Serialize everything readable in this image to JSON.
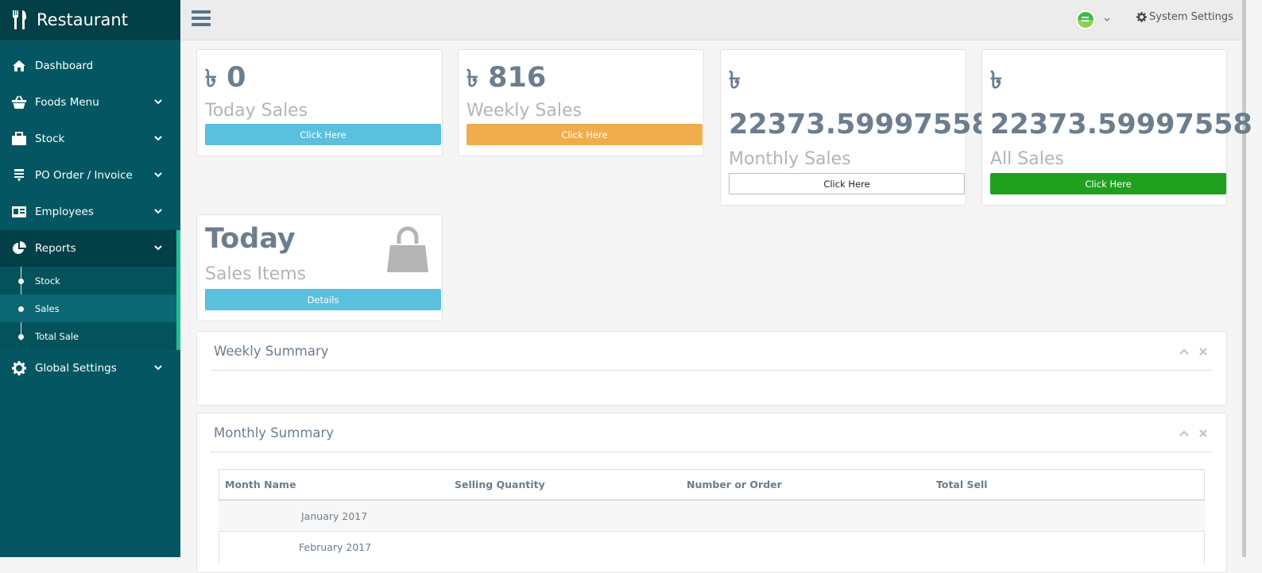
{
  "app": {
    "title": "Restaurant"
  },
  "sidebar": {
    "items": [
      {
        "label": "Dashboard",
        "icon": "home-icon"
      },
      {
        "label": "Foods Menu",
        "icon": "basket-icon"
      },
      {
        "label": "Stock",
        "icon": "briefcase-icon"
      },
      {
        "label": "PO Order / Invoice",
        "icon": "invoice-icon"
      },
      {
        "label": "Employees",
        "icon": "id-card-icon"
      },
      {
        "label": "Reports",
        "icon": "pie-chart-icon"
      },
      {
        "label": "Global Settings",
        "icon": "gear-icon"
      }
    ],
    "report_subitems": [
      {
        "label": "Stock"
      },
      {
        "label": "Sales"
      },
      {
        "label": "Total Sale"
      }
    ]
  },
  "topbar": {
    "settings_label": "System Settings"
  },
  "cards": {
    "currency_symbol": "৳",
    "today": {
      "amount": "0",
      "label": "Today Sales",
      "button": "Click Here",
      "color": "#5bc0de"
    },
    "weekly": {
      "amount": "816",
      "label": "Weekly Sales",
      "button": "Click Here",
      "color": "#f0ad4e"
    },
    "monthly": {
      "amount": "22373.59997558",
      "label": "Monthly Sales",
      "button": "Click Here",
      "color": "#ffffff"
    },
    "all": {
      "amount": "22373.59997558",
      "label": "All Sales",
      "button": "Click Here",
      "color": "#1fa11f"
    },
    "items": {
      "title": "Today",
      "label": "Sales Items",
      "button": "Details",
      "color": "#5bc0de"
    }
  },
  "panels": {
    "weekly": {
      "title": "Weekly Summary"
    },
    "monthly": {
      "title": "Monthly Summary",
      "columns": [
        "Month Name",
        "Selling Quantity",
        "Number or Order",
        "Total Sell"
      ],
      "rows": [
        {
          "month": "January 2017"
        },
        {
          "month": "February 2017"
        }
      ]
    }
  }
}
